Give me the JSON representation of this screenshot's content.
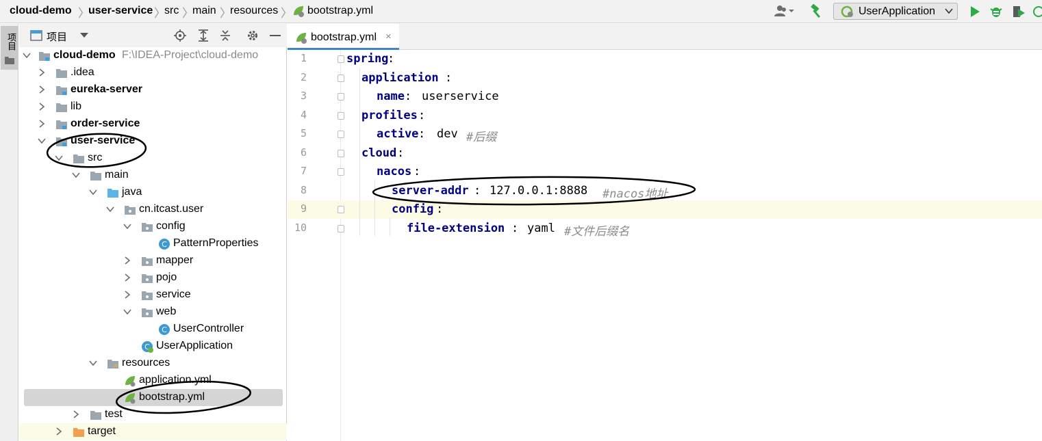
{
  "breadcrumb": {
    "items": [
      "cloud-demo",
      "user-service",
      "src",
      "main",
      "resources",
      "bootstrap.yml"
    ]
  },
  "toolbar": {
    "run_config": "UserApplication"
  },
  "toolstrip": {
    "project_tab_label": "项目"
  },
  "project_panel": {
    "title": "项目",
    "tree": [
      {
        "label": "cloud-demo",
        "path": "F:\\IDEA-Project\\cloud-demo"
      },
      {
        "label": ".idea"
      },
      {
        "label": "eureka-server"
      },
      {
        "label": "lib"
      },
      {
        "label": "order-service"
      },
      {
        "label": "user-service"
      },
      {
        "label": "src"
      },
      {
        "label": "main"
      },
      {
        "label": "java"
      },
      {
        "label": "cn.itcast.user"
      },
      {
        "label": "config"
      },
      {
        "label": "PatternProperties"
      },
      {
        "label": "mapper"
      },
      {
        "label": "pojo"
      },
      {
        "label": "service"
      },
      {
        "label": "web"
      },
      {
        "label": "UserController"
      },
      {
        "label": "UserApplication"
      },
      {
        "label": "resources"
      },
      {
        "label": "application.yml"
      },
      {
        "label": "bootstrap.yml"
      },
      {
        "label": "test"
      },
      {
        "label": "target"
      }
    ]
  },
  "editor": {
    "tab_label": "bootstrap.yml",
    "tab_close": "×",
    "line_numbers": [
      "1",
      "2",
      "3",
      "4",
      "5",
      "6",
      "7",
      "8",
      "9",
      "10"
    ],
    "lines": [
      {
        "key": "spring",
        "colon": ":",
        "value": "",
        "comment": ""
      },
      {
        "key": "application",
        "colon": ":",
        "value": "",
        "comment": ""
      },
      {
        "key": "name",
        "colon": ":",
        "value": "userservice",
        "comment": ""
      },
      {
        "key": "profiles",
        "colon": ":",
        "value": "",
        "comment": ""
      },
      {
        "key": "active",
        "colon": ":",
        "value": "dev",
        "comment": "#后缀"
      },
      {
        "key": "cloud",
        "colon": ":",
        "value": "",
        "comment": ""
      },
      {
        "key": "nacos",
        "colon": ":",
        "value": "",
        "comment": ""
      },
      {
        "key": "server-addr",
        "colon": ":",
        "value": "127.0.0.1:8888",
        "comment": "#nacos地址"
      },
      {
        "key": "config",
        "colon": ":",
        "value": "",
        "comment": ""
      },
      {
        "key": "file-extension",
        "colon": ":",
        "value": "yaml",
        "comment": "#文件后缀名"
      }
    ]
  },
  "colors": {
    "yaml_key": "#000080",
    "comment": "#8c8c8c",
    "selection": "#d5d5d5",
    "current_line": "#fcfbe6",
    "tab_accent": "#4083c9",
    "folder": "#9aa7b0",
    "module_marker": "#3aa0e0",
    "spring_leaf": "#6db33f",
    "run_green": "#2ea94a",
    "class_icon": "#3d9ad1",
    "target_folder": "#f0a050"
  }
}
